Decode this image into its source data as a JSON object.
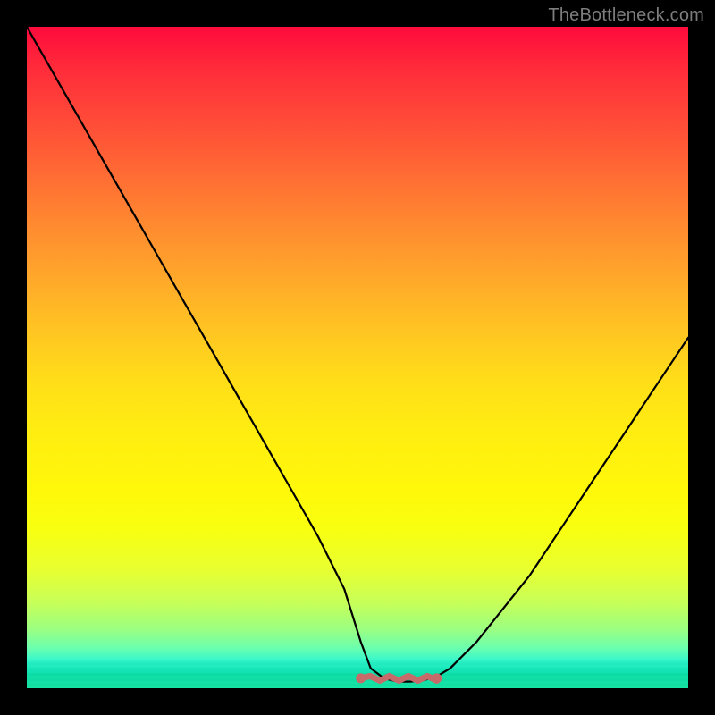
{
  "watermark": "TheBottleneck.com",
  "chart_data": {
    "type": "line",
    "title": "",
    "xlabel": "",
    "ylabel": "",
    "xlim": [
      0,
      100
    ],
    "ylim": [
      0,
      100
    ],
    "grid": false,
    "legend": false,
    "curve": {
      "x": [
        0,
        4,
        8,
        12,
        16,
        20,
        24,
        28,
        32,
        36,
        40,
        44,
        48,
        50.5,
        52,
        54,
        56,
        58,
        60,
        62,
        64,
        68,
        72,
        76,
        80,
        84,
        88,
        92,
        96,
        100
      ],
      "y": [
        100,
        93,
        86,
        79,
        72,
        65,
        58,
        51,
        44,
        37,
        30,
        23,
        15,
        7,
        3,
        1.5,
        1,
        1,
        1.2,
        1.8,
        3,
        7,
        12,
        17,
        23,
        29,
        35,
        41,
        47,
        53
      ]
    },
    "flat_segment": {
      "x_start": 50.5,
      "x_end": 62,
      "y": 1.5
    },
    "background_gradient": {
      "top": "#ff0a3c",
      "middle": "#ffe010",
      "bottom": "#15e2a4"
    }
  }
}
